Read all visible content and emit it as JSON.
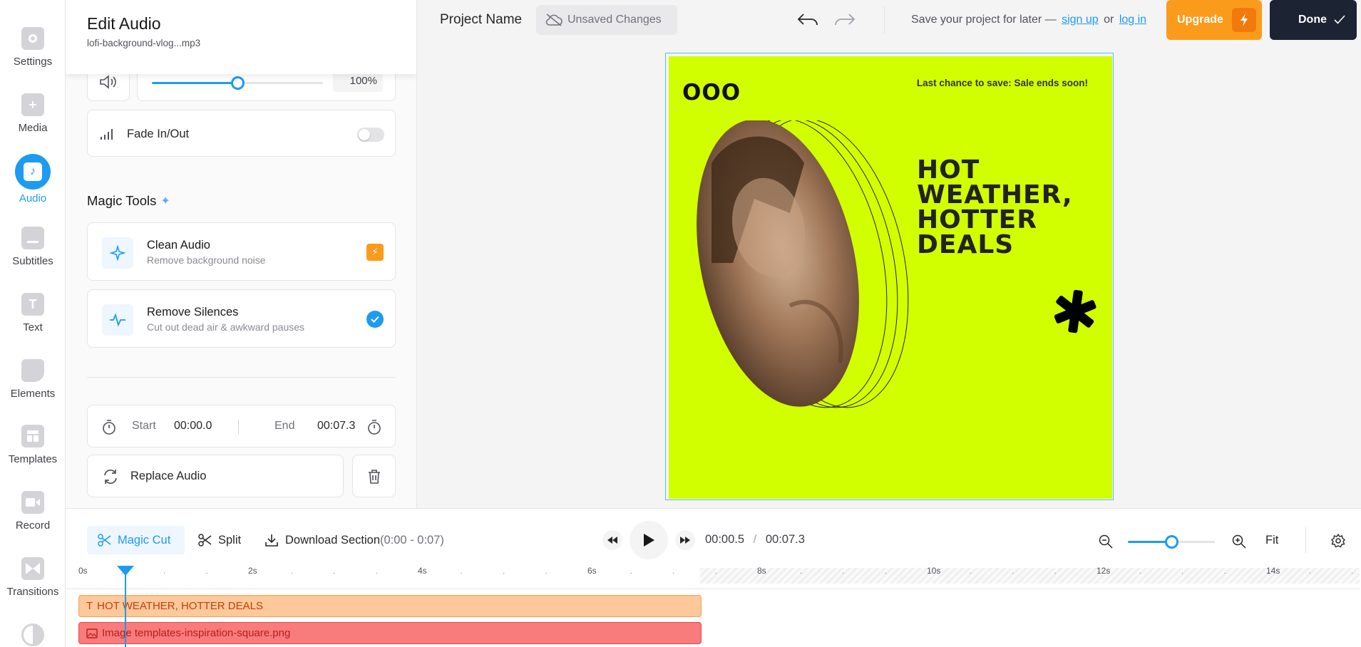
{
  "rail": {
    "items": [
      {
        "label": "Settings"
      },
      {
        "label": "Media"
      },
      {
        "label": "Audio"
      },
      {
        "label": "Subtitles"
      },
      {
        "label": "Text"
      },
      {
        "label": "Elements"
      },
      {
        "label": "Templates"
      },
      {
        "label": "Record"
      },
      {
        "label": "Transitions"
      }
    ]
  },
  "panel": {
    "title": "Edit Audio",
    "filename": "lofi-background-vlog...mp3",
    "volume": {
      "value": "100%",
      "level": 0.5
    },
    "fade_label": "Fade In/Out",
    "magic_tools_heading": "Magic Tools",
    "tools": [
      {
        "title": "Clean Audio",
        "desc": "Remove background noise"
      },
      {
        "title": "Remove Silences",
        "desc": "Cut out dead air & awkward pauses"
      }
    ],
    "start_label": "Start",
    "start_value": "00:00.0",
    "end_label": "End",
    "end_value": "00:07.3",
    "replace_label": "Replace Audio"
  },
  "topbar": {
    "project_name": "Project Name",
    "unsaved": "Unsaved Changes",
    "save_prompt": "Save your project for later —",
    "sign_up": "sign up",
    "or": "or",
    "log_in": "log in",
    "upgrade": "Upgrade",
    "done": "Done"
  },
  "canvas": {
    "logo": "OOO",
    "promo": "Last chance to save: Sale ends soon!",
    "headline_1": "HOT",
    "headline_2": "WEATHER,",
    "headline_3": "HOTTER",
    "headline_4": "DEALS",
    "colors": {
      "background": "#d2ff00",
      "text": "#222222"
    }
  },
  "timeline": {
    "magic_cut": "Magic Cut",
    "split": "Split",
    "download": "Download Section",
    "download_range": "(0:00 - 0:07)",
    "current_time": "00:00.5",
    "separator": "/",
    "total_time": "00:07.3",
    "fit": "Fit",
    "ticks": [
      "0s",
      "2s",
      "4s",
      "6s",
      "8s",
      "10s",
      "12s",
      "14s"
    ],
    "tracks": [
      {
        "label": "HOT WEATHER, HOTTER DEALS",
        "color": "#fdc89a"
      },
      {
        "label": "Image templates-inspiration-square.png",
        "color": "#f87c7c"
      }
    ]
  },
  "colors": {
    "accent": "#1d9bf0",
    "upgrade": "#fb9b1c",
    "done": "#1c2333"
  }
}
